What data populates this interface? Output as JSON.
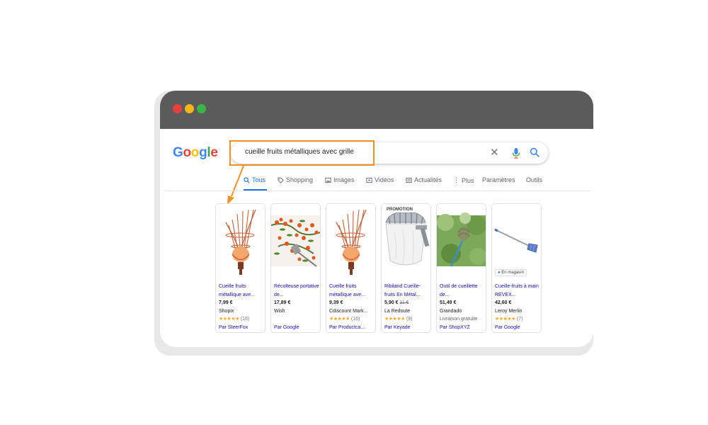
{
  "search": {
    "query": "cueille fruits métalliques avec grille"
  },
  "logo": [
    "G",
    "o",
    "o",
    "g",
    "l",
    "e"
  ],
  "logo_colors": [
    "#4285f4",
    "#ea4335",
    "#fbbc05",
    "#4285f4",
    "#34a853",
    "#ea4335"
  ],
  "tabs": [
    {
      "label": "Tous",
      "icon": "search-icon"
    },
    {
      "label": "Shopping",
      "icon": "tag-icon"
    },
    {
      "label": "Images",
      "icon": "image-icon"
    },
    {
      "label": "Vidéos",
      "icon": "play-icon"
    },
    {
      "label": "Actualités",
      "icon": "news-icon"
    },
    {
      "label": "Plus",
      "icon": "more-vert-icon"
    },
    {
      "label": "Paramètres"
    },
    {
      "label": "Outils"
    }
  ],
  "products": [
    {
      "title": "Cueille fruits métallique ave...",
      "price": "7,99 €",
      "seller": "Shopix",
      "stars": "★★★★★",
      "reviews": "(16)",
      "by": "Par SteerFox"
    },
    {
      "title": "Récolteuse portative de...",
      "price": "17,89 €",
      "seller": "Wish",
      "by": "Par Google"
    },
    {
      "title": "Cueille fruits métallique ave...",
      "price": "9,39 €",
      "seller": "Cdiscount Mark...",
      "stars": "★★★★★",
      "reviews": "(16)",
      "by": "Par Productca..."
    },
    {
      "title": "Ribiland Cueille-fruits En Métal...",
      "price": "5,90 €",
      "old_price": "11 €",
      "seller": "La Redoute",
      "stars": "★★★★★",
      "reviews": "(9)",
      "by": "Par Keyade",
      "badge": "PROMOTION"
    },
    {
      "title": "Outil de cueillette de...",
      "price": "51,49 €",
      "seller": "Grandado",
      "shipping": "Livraison gratuite",
      "by": "Par ShopXYZ"
    },
    {
      "title": "Cueille-fruits à main REVEX...",
      "price": "42,60 €",
      "seller": "Leroy Merlin",
      "stars": "★★★★★",
      "reviews": "(7)",
      "by": "Par Google",
      "badge": "En magasin"
    }
  ],
  "colors": {
    "accent": "#1a73e8",
    "highlight": "#f29222",
    "title_link": "#1a0dab",
    "titlebar": "#5b5b5b"
  }
}
